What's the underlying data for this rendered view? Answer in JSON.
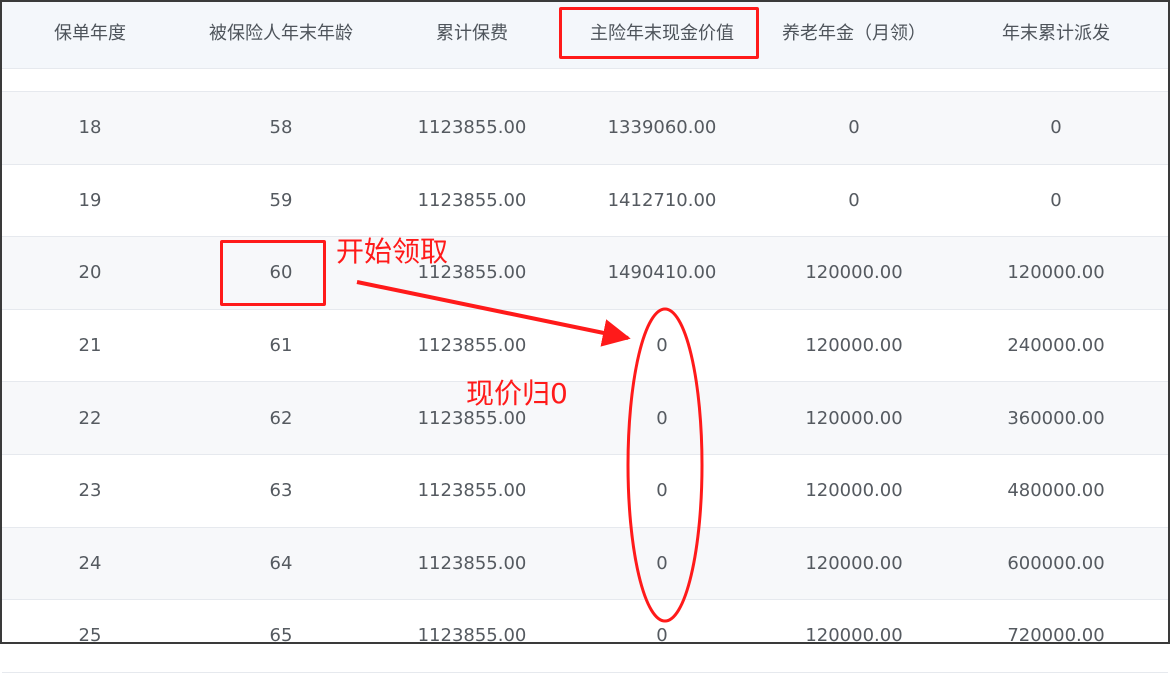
{
  "table": {
    "columns": [
      "保单年度",
      "被保险人年末年龄",
      "累计保费",
      "主险年末现金价值",
      "养老年金（月领）",
      "年末累计派发"
    ],
    "rows": [
      [
        "18",
        "58",
        "1123855.00",
        "1339060.00",
        "0",
        "0"
      ],
      [
        "19",
        "59",
        "1123855.00",
        "1412710.00",
        "0",
        "0"
      ],
      [
        "20",
        "60",
        "1123855.00",
        "1490410.00",
        "120000.00",
        "120000.00"
      ],
      [
        "21",
        "61",
        "1123855.00",
        "0",
        "120000.00",
        "240000.00"
      ],
      [
        "22",
        "62",
        "1123855.00",
        "0",
        "120000.00",
        "360000.00"
      ],
      [
        "23",
        "63",
        "1123855.00",
        "0",
        "120000.00",
        "480000.00"
      ],
      [
        "24",
        "64",
        "1123855.00",
        "0",
        "120000.00",
        "600000.00"
      ],
      [
        "25",
        "65",
        "1123855.00",
        "0",
        "120000.00",
        "720000.00"
      ]
    ]
  },
  "annotations": {
    "start_label": "开始领取",
    "zero_label": "现价归0",
    "color": "#ff1a1a"
  },
  "colors": {
    "header_bg": "#f4f7fb",
    "row_alt_bg": "#f7f8fa",
    "divider": "#e6e9ee",
    "text": "#555a60"
  }
}
